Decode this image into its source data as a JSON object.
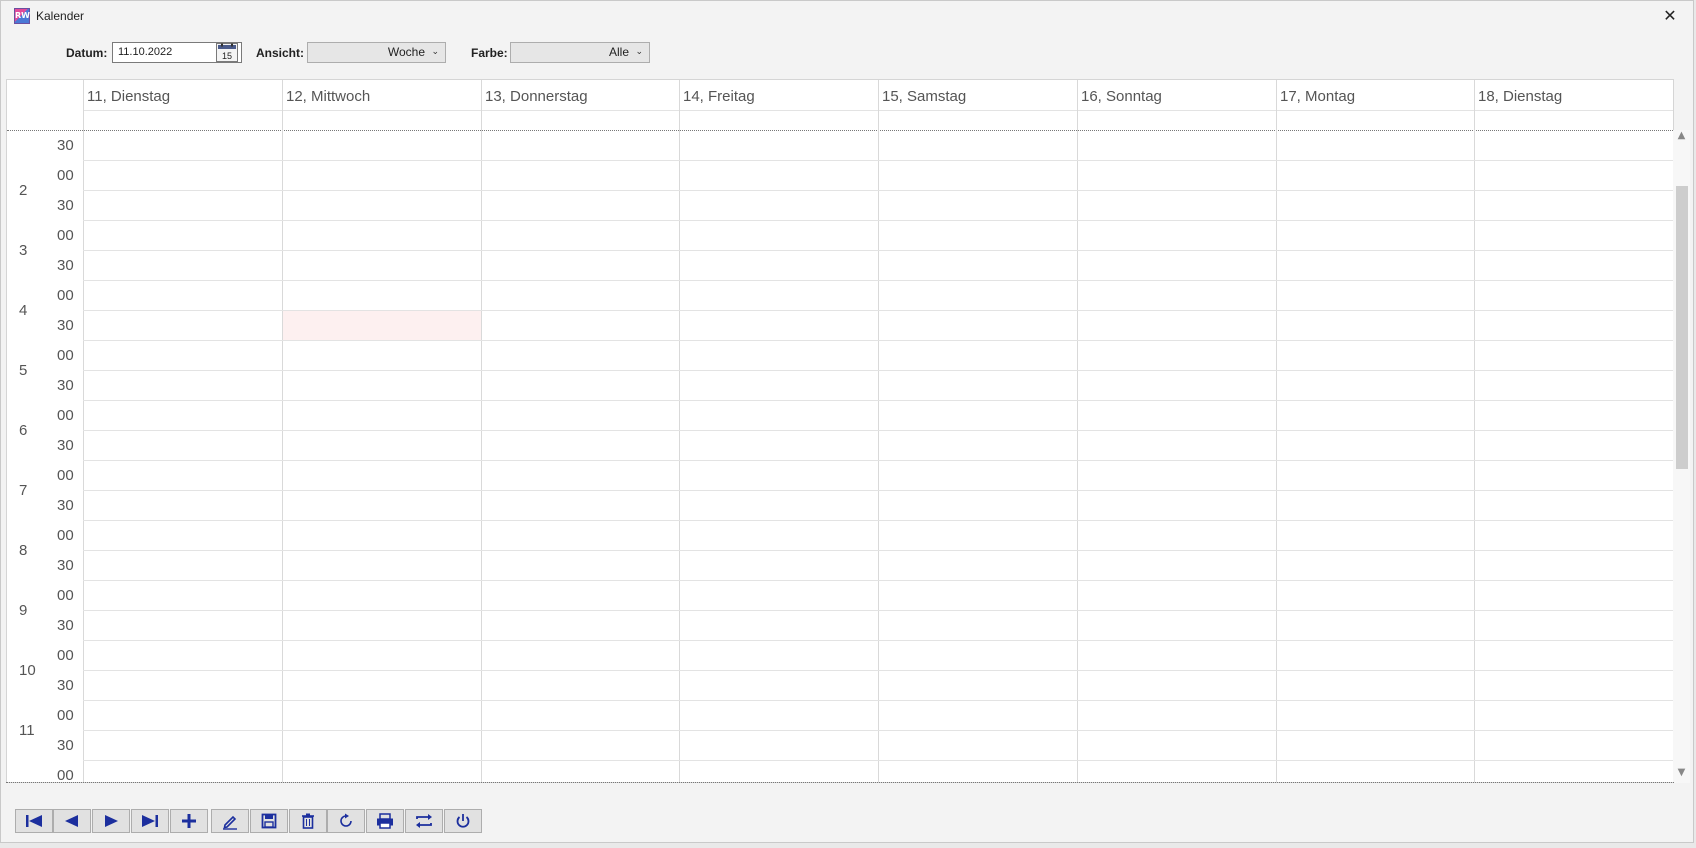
{
  "window": {
    "title": "Kalender",
    "close_glyph": "✕",
    "app_icon_text": "RW"
  },
  "toolbar": {
    "date_label": "Datum:",
    "date_value": "11.10.2022",
    "calendar_icon_day": "15",
    "view_label": "Ansicht:",
    "view_value": "Woche",
    "color_label": "Farbe:",
    "color_value": "Alle"
  },
  "calendar": {
    "days": [
      "11, Dienstag",
      "12, Mittwoch",
      "13, Donnerstag",
      "14, Freitag",
      "15, Samstag",
      "16, Sonntag",
      "17, Montag",
      "18, Dienstag"
    ],
    "time_rows": [
      "30",
      "00",
      "30",
      "00",
      "30",
      "00",
      "30",
      "00",
      "30",
      "00",
      "30",
      "00",
      "30",
      "00",
      "30",
      "00",
      "30",
      "00",
      "30",
      "00",
      "30",
      "00",
      "00"
    ],
    "hours": [
      "2",
      "3",
      "4",
      "5",
      "6",
      "7",
      "8",
      "9",
      "10",
      "11"
    ],
    "highlighted_cell": {
      "day": "12, Mittwoch",
      "hour": "4",
      "minute": "30"
    }
  },
  "footer_buttons": [
    {
      "name": "first-record-button",
      "icon": "skip-first-icon"
    },
    {
      "name": "previous-button",
      "icon": "arrow-left-icon"
    },
    {
      "name": "next-button",
      "icon": "arrow-right-icon"
    },
    {
      "name": "last-record-button",
      "icon": "skip-last-icon"
    },
    {
      "name": "add-button",
      "icon": "plus-icon"
    },
    {
      "name": "edit-button",
      "icon": "pencil-icon"
    },
    {
      "name": "save-button",
      "icon": "floppy-icon"
    },
    {
      "name": "delete-button",
      "icon": "trash-icon"
    },
    {
      "name": "refresh-button",
      "icon": "refresh-icon"
    },
    {
      "name": "print-button",
      "icon": "printer-icon"
    },
    {
      "name": "switch-button",
      "icon": "swap-icon"
    },
    {
      "name": "power-button",
      "icon": "power-icon"
    }
  ],
  "colors": {
    "icon_blue": "#1c2f9e",
    "highlight": "#fdf0f0"
  }
}
